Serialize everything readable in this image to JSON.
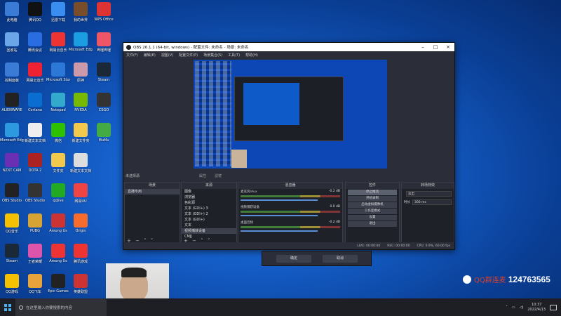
{
  "desktop": {
    "icons": [
      {
        "label": "此电脑",
        "color": "#3a7bd5"
      },
      {
        "label": "腾讯QQ",
        "color": "#111"
      },
      {
        "label": "迅雷下载",
        "color": "#3a8ef0"
      },
      {
        "label": "我的世界",
        "color": "#7a4d2a"
      },
      {
        "label": "WPS Office",
        "color": "#d33"
      },
      {
        "label": "回收站",
        "color": "#6aa6e8"
      },
      {
        "label": "腾讯会议",
        "color": "#2a6de0"
      },
      {
        "label": "网易云音乐",
        "color": "#e33"
      },
      {
        "label": "Microsoft Edge",
        "color": "#1b9de2"
      },
      {
        "label": "哔哩哔哩",
        "color": "#e56"
      },
      {
        "label": "控制面板",
        "color": "#3a7bd5"
      },
      {
        "label": "网易云音乐",
        "color": "#e23"
      },
      {
        "label": "Microsoft Store",
        "color": "#2b78d6"
      },
      {
        "label": "原神",
        "color": "#c9a"
      },
      {
        "label": "Steam",
        "color": "#1b2838"
      },
      {
        "label": "ALIENWARE",
        "color": "#222"
      },
      {
        "label": "Cortana",
        "color": "#0a6ed1"
      },
      {
        "label": "Notepad",
        "color": "#3ac"
      },
      {
        "label": "NVIDIA",
        "color": "#76b900"
      },
      {
        "label": "CSGO",
        "color": "#333"
      },
      {
        "label": "Microsoft Edge",
        "color": "#2d9ae0"
      },
      {
        "label": "新建文本文档",
        "color": "#eee"
      },
      {
        "label": "微信",
        "color": "#2dc100"
      },
      {
        "label": "新建文件夹",
        "color": "#f2c94c"
      },
      {
        "label": "MuMu",
        "color": "#4a4"
      },
      {
        "label": "NZXT CAM",
        "color": "#6b2fb3"
      },
      {
        "label": "DOTA 2",
        "color": "#a22"
      },
      {
        "label": "文件夹",
        "color": "#f2c94c"
      },
      {
        "label": "新建文本文档",
        "color": "#ddd"
      },
      {
        "label": "OBS Studio",
        "color": "#222"
      },
      {
        "label": "OBS Studio",
        "color": "#333"
      },
      {
        "label": "qqlive",
        "color": "#2a2"
      },
      {
        "label": "网易UU",
        "color": "#e44"
      },
      {
        "label": "QQ音乐",
        "color": "#f5c000"
      },
      {
        "label": "PUBG",
        "color": "#d8a335"
      },
      {
        "label": "Among Us",
        "color": "#c33"
      },
      {
        "label": "Origin",
        "color": "#f56c2d"
      },
      {
        "label": "Steam",
        "color": "#1b2838"
      },
      {
        "label": "王者荣耀",
        "color": "#d5a"
      },
      {
        "label": "Among Us",
        "color": "#e33"
      },
      {
        "label": "腾讯游戏",
        "color": "#e33"
      },
      {
        "label": "QQ游戏",
        "color": "#f5c000"
      },
      {
        "label": "QQ飞车",
        "color": "#e8a33d"
      },
      {
        "label": "Epic Games",
        "color": "#222"
      },
      {
        "label": "英雄联盟",
        "color": "#c33"
      }
    ]
  },
  "obs": {
    "title": "OBS 26.1.1 (64-bit, windows) - 配置文件: 未命名 - 场景: 未命名",
    "menu": [
      "文件(F)",
      "编辑(E)",
      "视图(V)",
      "配置文件(P)",
      "场景集合(S)",
      "工具(T)",
      "帮助(H)"
    ],
    "scene_label": "未选择源",
    "tool_props": "属性",
    "tool_filters": "滤镜",
    "scenes_header": "场景",
    "scenes": [
      "场景",
      "直播专用"
    ],
    "sources_header": "来源",
    "sources": [
      "图像",
      "浏览器",
      "色彩源",
      "文本 (GDI+) 3",
      "文本 (GDI+) 2",
      "文本 (GDI+)",
      "文本",
      "视频捕获设备",
      "CMJJ"
    ],
    "selected_source_index": 7,
    "mixer_header": "混音器",
    "mixer": [
      {
        "name": "麦克风/Aux",
        "db": "-0.2 dB"
      },
      {
        "name": "视频捕获设备",
        "db": "0.0 dB"
      },
      {
        "name": "桌面音频",
        "db": "-0.2 dB"
      }
    ],
    "controls_header": "控件",
    "controls": [
      "停止推流",
      "开始录制",
      "启动虚拟摄像机",
      "工作室模式",
      "设置",
      "退出"
    ],
    "transitions_header": "转场特效",
    "transition_type": "淡出",
    "duration_label": "时长",
    "duration_value": "300 ms",
    "status": [
      "LIVE: 00:00:00",
      "REC: 00:00:00",
      "CPU: 0.9%, 60.00 fps"
    ],
    "dock_foot": "+ − ˄ ˅"
  },
  "dialog": {
    "btn1": "确定",
    "btn2": "取消"
  },
  "overlay": {
    "qq_group_label": "QQ群连麦",
    "qq_group_number": "124763565"
  },
  "taskbar": {
    "search_placeholder": "在这里输入你要搜索的内容",
    "time": "10:37",
    "date": "2022/4/13"
  }
}
